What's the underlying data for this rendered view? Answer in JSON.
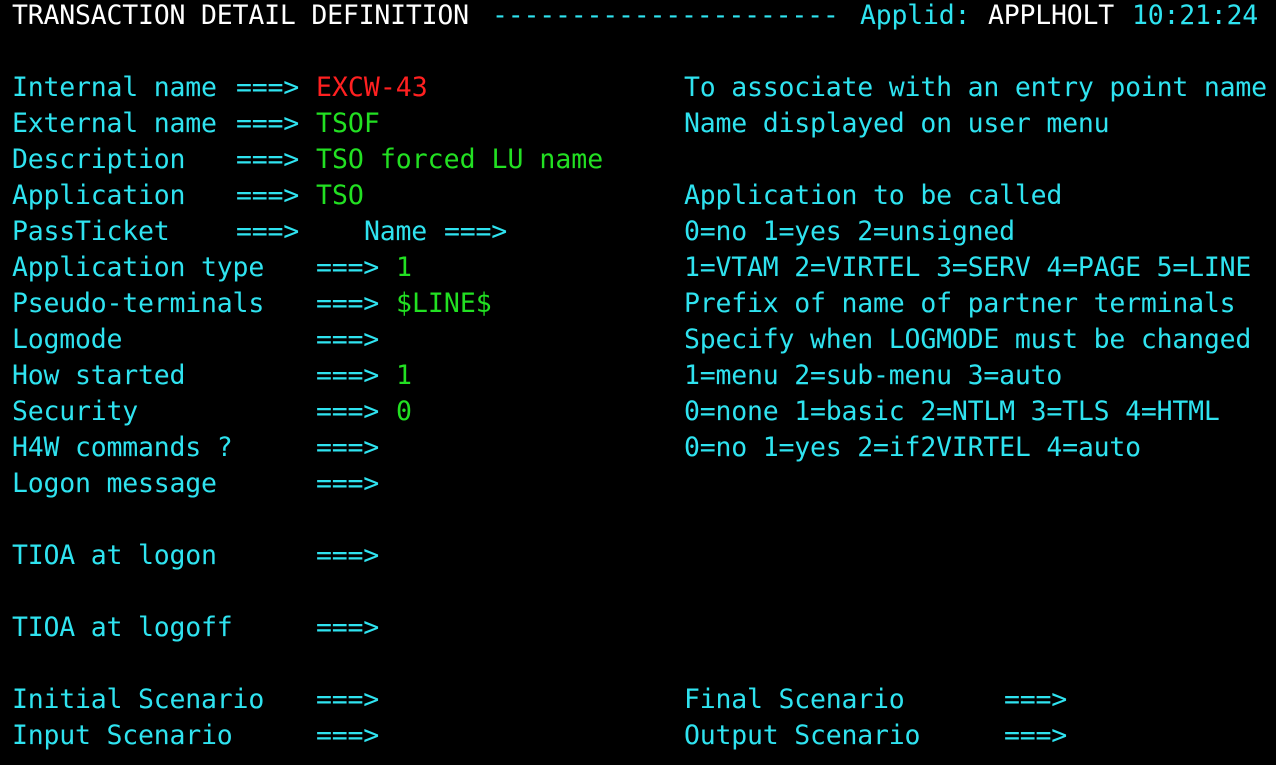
{
  "header": {
    "title": "TRANSACTION DETAIL DEFINITION",
    "dashes": "----------------------",
    "applid_label": "Applid:",
    "applid_value": "APPLHOLT",
    "time": "10:21:24"
  },
  "arrow": "===>",
  "fields": {
    "internal_name": {
      "label": "Internal name",
      "value": "EXCW-43",
      "help": "To associate with an entry point name"
    },
    "external_name": {
      "label": "External name",
      "value": "TSOF",
      "help": "Name displayed on user menu"
    },
    "description": {
      "label": "Description",
      "value": "TSO forced LU name"
    },
    "application": {
      "label": "Application",
      "value": "TSO",
      "help": "Application to be called"
    },
    "passticket": {
      "label": "PassTicket",
      "value": "",
      "name_label": "Name",
      "name_value": "",
      "help": "0=no 1=yes 2=unsigned"
    },
    "application_type": {
      "label": "Application type",
      "value": "1",
      "help": "1=VTAM 2=VIRTEL 3=SERV 4=PAGE 5=LINE"
    },
    "pseudo_terminals": {
      "label": "Pseudo-terminals",
      "value": "$LINE$",
      "help": "Prefix of name of partner terminals"
    },
    "logmode": {
      "label": "Logmode",
      "value": "",
      "help": "Specify when LOGMODE must be changed"
    },
    "how_started": {
      "label": "How started",
      "value": "1",
      "help": "1=menu 2=sub-menu 3=auto"
    },
    "security": {
      "label": "Security",
      "value": "0",
      "help": "0=none 1=basic 2=NTLM 3=TLS 4=HTML"
    },
    "h4w_commands": {
      "label": "H4W commands ?",
      "value": "",
      "help": "0=no 1=yes 2=if2VIRTEL 4=auto"
    },
    "logon_message": {
      "label": "Logon message",
      "value": ""
    },
    "tioa_logon": {
      "label": "TIOA at logon",
      "value": ""
    },
    "tioa_logoff": {
      "label": "TIOA at logoff",
      "value": ""
    },
    "initial_scenario": {
      "label": "Initial Scenario",
      "value": ""
    },
    "final_scenario": {
      "label": "Final Scenario",
      "value": ""
    },
    "input_scenario": {
      "label": "Input Scenario",
      "value": ""
    },
    "output_scenario": {
      "label": "Output Scenario",
      "value": ""
    }
  },
  "colors": {
    "background": "#000000",
    "label": "#2fe3f0",
    "value": "#22e022",
    "key_value": "#ff2020",
    "title": "#ffffff"
  }
}
